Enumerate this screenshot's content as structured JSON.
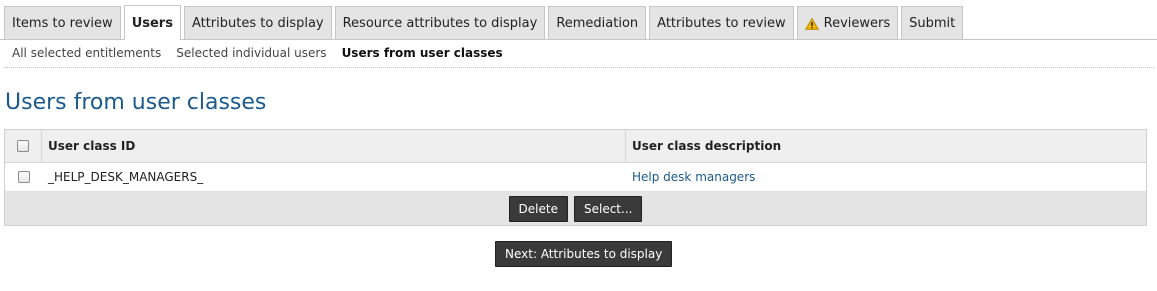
{
  "tabs": [
    {
      "label": "Items to review",
      "active": false
    },
    {
      "label": "Users",
      "active": true
    },
    {
      "label": "Attributes to display",
      "active": false
    },
    {
      "label": "Resource attributes to display",
      "active": false
    },
    {
      "label": "Remediation",
      "active": false
    },
    {
      "label": "Attributes to review",
      "active": false
    },
    {
      "label": "Reviewers",
      "active": false,
      "icon": "warning-icon"
    },
    {
      "label": "Submit",
      "active": false
    }
  ],
  "subnav": [
    {
      "label": "All selected entitlements",
      "current": false
    },
    {
      "label": "Selected individual users",
      "current": false
    },
    {
      "label": "Users from user classes",
      "current": true
    }
  ],
  "page_title": "Users from user classes",
  "grid": {
    "columns": [
      "User class ID",
      "User class description"
    ],
    "rows": [
      {
        "id": "_HELP_DESK_MANAGERS_",
        "description": "Help desk managers"
      }
    ],
    "buttons": {
      "delete": "Delete",
      "select": "Select..."
    }
  },
  "next_button": "Next: Attributes to display",
  "colors": {
    "title": "#1b5a8c",
    "link": "#1b5a8c",
    "button": "#3a3a3a",
    "warning": "#f0b400"
  }
}
